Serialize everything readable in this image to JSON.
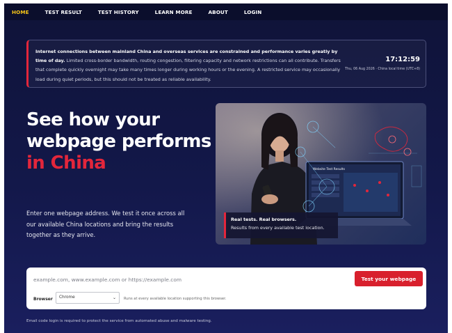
{
  "nav": {
    "items": [
      {
        "label": "HOME",
        "active": true
      },
      {
        "label": "TEST RESULT",
        "active": false
      },
      {
        "label": "TEST HISTORY",
        "active": false
      },
      {
        "label": "LEARN MORE",
        "active": false
      },
      {
        "label": "ABOUT",
        "active": false
      },
      {
        "label": "LOGIN",
        "active": false
      }
    ]
  },
  "notice": {
    "bold_text": "Internet connections between mainland China and overseas services are constrained and performance varies greatly by time of day.",
    "text": " Limited cross-border bandwidth, routing congestion, filtering capacity and network restrictions can all contribute. Transfers that complete quickly overnight may take many times longer during working hours or the evening. A restricted service may occasionally load during quiet periods, but this should not be treated as reliable availability.",
    "time": "17:12:59",
    "date": "Thu, 06 Aug 2026 · China local time (UTC+8)"
  },
  "hero": {
    "headline_line1": "See how your",
    "headline_line2": "webpage performs",
    "headline_accent": "in China",
    "intro": "Enter one webpage address. We test it once across all our available China locations and bring the results together as they arrive.",
    "image_caption_title": "Real tests. Real browsers.",
    "image_caption_sub": "Results from every available test location.",
    "laptop_title": "Website Test Results"
  },
  "form": {
    "url_placeholder": "example.com, www.example.com or https://example.com",
    "url_value": "",
    "submit_label": "Test your webpage",
    "browser_label": "Browser",
    "browser_selected": "Chrome",
    "browser_note": "Runs at every available location supporting this browser."
  },
  "footnote": "Email code login is required to protect the service from automated abuse and malware testing.",
  "colors": {
    "accent_red": "#e3263b",
    "nav_active": "#f5c518",
    "background": "#13184a"
  }
}
